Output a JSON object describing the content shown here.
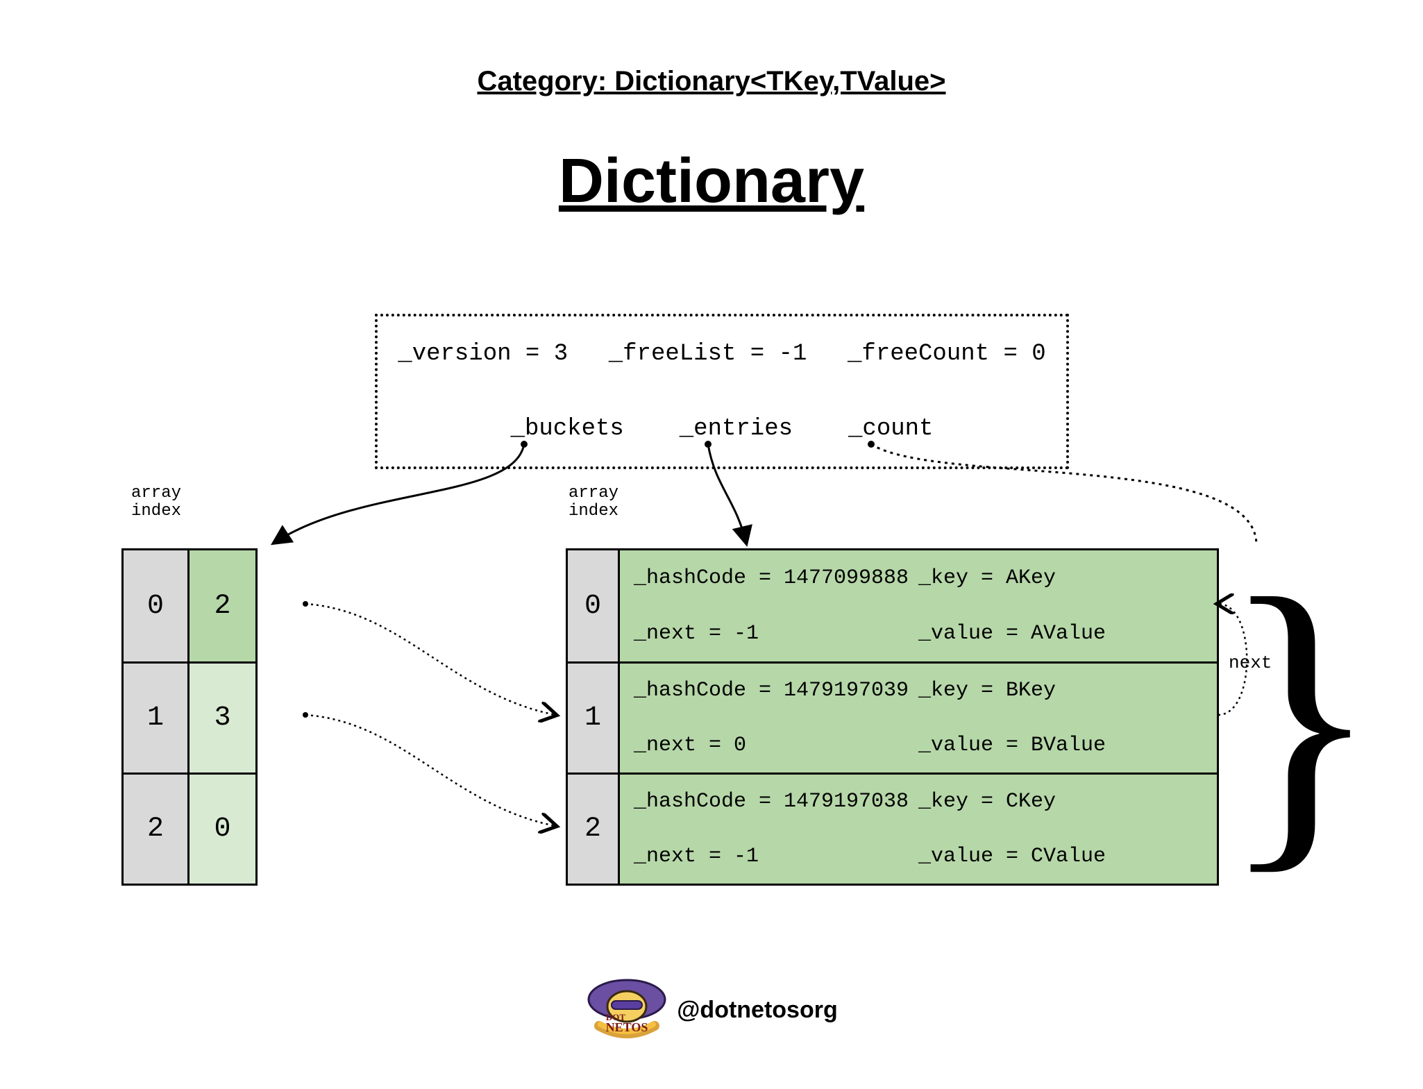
{
  "category": "Category: Dictionary<TKey,TValue>",
  "title": "Dictionary",
  "struct": {
    "version": "_version = 3",
    "freeList": "_freeList = -1",
    "freeCount": "_freeCount = 0",
    "buckets_label": "_buckets",
    "entries_label": "_entries",
    "count_label": "_count"
  },
  "labels": {
    "array_index": "array\nindex",
    "next": "next"
  },
  "buckets": [
    {
      "index": "0",
      "value": "2",
      "shade": "dark"
    },
    {
      "index": "1",
      "value": "3",
      "shade": "light"
    },
    {
      "index": "2",
      "value": "0",
      "shade": "light"
    }
  ],
  "entries": [
    {
      "index": "0",
      "hashCode": "_hashCode = 1477099888",
      "next": "_next = -1",
      "key": "_key = AKey",
      "value": "_value = AValue"
    },
    {
      "index": "1",
      "hashCode": "_hashCode = 1479197039",
      "next": "_next = 0",
      "key": "_key = BKey",
      "value": "_value = BValue"
    },
    {
      "index": "2",
      "hashCode": "_hashCode = 1479197038",
      "next": "_next = -1",
      "key": "_key = CKey",
      "value": "_value = CValue"
    }
  ],
  "footer": {
    "handle": "@dotnetosorg"
  }
}
